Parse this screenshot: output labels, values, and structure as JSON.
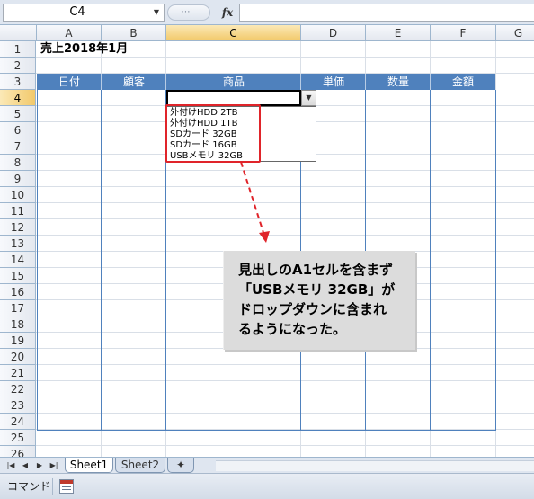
{
  "formula_bar": {
    "name_box": "C4",
    "fx_label": "fx",
    "formula": ""
  },
  "columns": [
    "A",
    "B",
    "C",
    "D",
    "E",
    "F",
    "G"
  ],
  "selected_column": "C",
  "rows": [
    "1",
    "2",
    "3",
    "4",
    "5",
    "6",
    "7",
    "8",
    "9",
    "10",
    "11",
    "12",
    "13",
    "14",
    "15",
    "16",
    "17",
    "18",
    "19",
    "20",
    "21",
    "22",
    "23",
    "24",
    "25",
    "26"
  ],
  "selected_row": "4",
  "sheet": {
    "title": "売上2018年1月",
    "headers": [
      "日付",
      "顧客",
      "商品",
      "単価",
      "数量",
      "金額"
    ],
    "header_color": "#4f81bd"
  },
  "dropdown": {
    "items": [
      "外付けHDD 2TB",
      "外付けHDD 1TB",
      "SDカード 32GB",
      "SDカード 16GB",
      "USBメモリ 32GB"
    ]
  },
  "callout": {
    "lines": [
      "見出しのA1セルを含まず",
      "「USBメモリ 32GB」が",
      "ドロップダウンに含まれ",
      "るようになった。"
    ]
  },
  "highlight_color": "#e0242a",
  "tabs": [
    "Sheet1",
    "Sheet2"
  ],
  "active_tab": "Sheet1",
  "status": {
    "mode": "コマンド"
  }
}
